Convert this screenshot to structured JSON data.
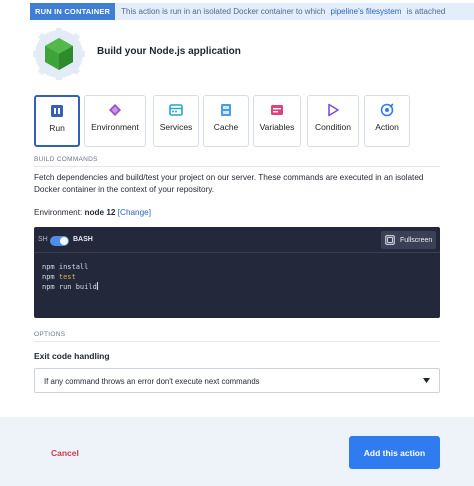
{
  "banner": {
    "tag": "RUN IN CONTAINER",
    "text_before": "This action is run in an isolated Docker container to which",
    "link": "pipeline's filesystem",
    "text_after": "is attached"
  },
  "header": {
    "title": "Build your Node.js application",
    "icon": "nodejs-hexagon-icon"
  },
  "tabs": [
    {
      "label": "Run",
      "icon": "run-icon",
      "active": true
    },
    {
      "label": "Environment",
      "icon": "environment-icon",
      "active": false
    },
    {
      "label": "Services",
      "icon": "services-icon",
      "active": false
    },
    {
      "label": "Cache",
      "icon": "cache-icon",
      "active": false
    },
    {
      "label": "Variables",
      "icon": "variables-icon",
      "active": false
    },
    {
      "label": "Condition",
      "icon": "condition-icon",
      "active": false
    },
    {
      "label": "Action",
      "icon": "action-icon",
      "active": false
    }
  ],
  "build_commands": {
    "section_label": "BUILD COMMANDS",
    "description": "Fetch dependencies and build/test your project on our server. These commands are executed in an isolated Docker container in the context of your repository.",
    "environment_label": "Environment:",
    "environment_value": "node 12",
    "change_link": "[Change]"
  },
  "editor": {
    "sh_label": "SH",
    "toggle_on": true,
    "bash_label": "BASH",
    "fullscreen_label": "Fullscreen",
    "lines": [
      {
        "cmd": "npm install",
        "parts": [
          {
            "text": "npm install",
            "kw": false
          }
        ]
      },
      {
        "cmd": "npm test",
        "parts": [
          {
            "text": "npm ",
            "kw": false
          },
          {
            "text": "test",
            "kw": true
          }
        ]
      },
      {
        "cmd": "npm run build",
        "parts": [
          {
            "text": "npm run build",
            "kw": false
          }
        ]
      }
    ]
  },
  "options": {
    "section_label": "OPTIONS",
    "exit_code_label": "Exit code handling",
    "exit_code_value": "If any command throws an error don't execute next commands"
  },
  "footer": {
    "cancel_label": "Cancel",
    "add_label": "Add this action"
  },
  "colors": {
    "accent": "#2f7cf0",
    "active_tab_border": "#3461b3",
    "cancel": "#d1394b",
    "editor_bg": "#23283a",
    "node_green": "#3ea33a"
  }
}
